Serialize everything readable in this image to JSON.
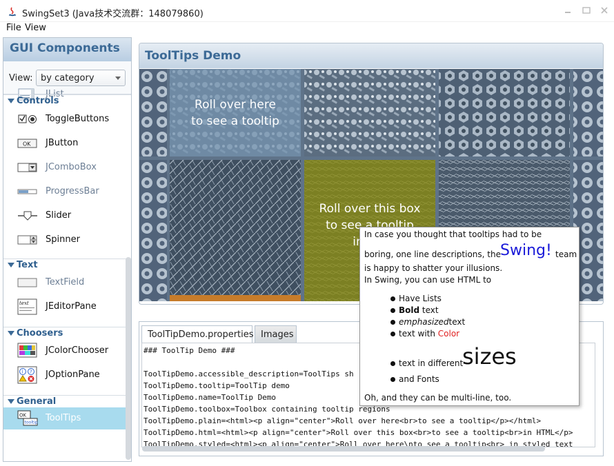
{
  "window": {
    "title": "SwingSet3 (Java技术交流群：148079860)"
  },
  "menu": {
    "file": "File",
    "view": "View"
  },
  "left_panel": {
    "title": "GUI Components",
    "view_label": "View:",
    "view_selected": "by category",
    "partial_item": "JList",
    "categories": [
      {
        "label": "Controls",
        "items": [
          {
            "label": "ToggleButtons",
            "enabled": true
          },
          {
            "label": "JButton",
            "enabled": true
          },
          {
            "label": "JComboBox",
            "enabled": false
          },
          {
            "label": "ProgressBar",
            "enabled": false
          },
          {
            "label": "Slider",
            "enabled": true
          },
          {
            "label": "Spinner",
            "enabled": true
          }
        ]
      },
      {
        "label": "Text",
        "items": [
          {
            "label": "TextField",
            "enabled": false
          },
          {
            "label": "JEditorPane",
            "enabled": true
          }
        ]
      },
      {
        "label": "Choosers",
        "items": [
          {
            "label": "JColorChooser",
            "enabled": true
          },
          {
            "label": "JOptionPane",
            "enabled": true
          }
        ]
      },
      {
        "label": "General",
        "items": [
          {
            "label": "ToolTips",
            "enabled": true,
            "selected": true
          }
        ]
      }
    ],
    "editor_icon_text": "text",
    "ok_icon_text": "OK",
    "tooltip_icon_text": "tooltip",
    "ok_button_icon_text": "OK"
  },
  "demo": {
    "title": "ToolTips Demo",
    "rollover_1_line1": "Roll over here",
    "rollover_1_line2": "to see a tooltip",
    "rollover_2_line1": "Roll over this box",
    "rollover_2_line2": "to see a tooltip",
    "rollover_2_line3": "in"
  },
  "tabs": {
    "properties": "ToolTipDemo.properties",
    "images": "Images"
  },
  "code_lines": [
    "### ToolTip Demo ###",
    "",
    "ToolTipDemo.accessible_description=ToolTips sh",
    "ToolTipDemo.tooltip=ToolTip demo",
    "ToolTipDemo.name=ToolTip Demo",
    "ToolTipDemo.toolbox=Toolbox containing tooltip regions",
    "ToolTipDemo.plain=<html><p align=\"center\">Roll over here<br>to see a tooltip</p></html>",
    "ToolTipDemo.html=<html><p align=\"center\">Roll over this box<br>to see a tooltip<br>in HTML</p>",
    "ToolTipDemo.styled=<html><p align=\"center\">Roll over here\\nto see a tooltip<br> in styled text"
  ],
  "tooltip": {
    "line1": "In case you thought that tooltips had to be",
    "line2_a": "boring, one line descriptions, the",
    "line2_swing": "Swing!",
    "line2_b": "team",
    "line3": "is happy to shatter your illusions.",
    "line4": "In Swing, you can use HTML to",
    "bullet1": "Have Lists",
    "bullet2_bold": "Bold",
    "bullet2_rest": " text",
    "bullet3_em": "emphasized",
    "bullet3_rest": "text",
    "bullet4_a": "text with ",
    "bullet4_color": "Color",
    "bullet5_a": "text in different",
    "bullet5_big": "sizes",
    "bullet6": "and Fonts",
    "last": "Oh, and they can be multi-line, too."
  },
  "colors": {
    "accent": "#3c6a96",
    "selection": "#a8dbee",
    "swing_blue": "#1a1ad8",
    "red": "#e02020"
  }
}
